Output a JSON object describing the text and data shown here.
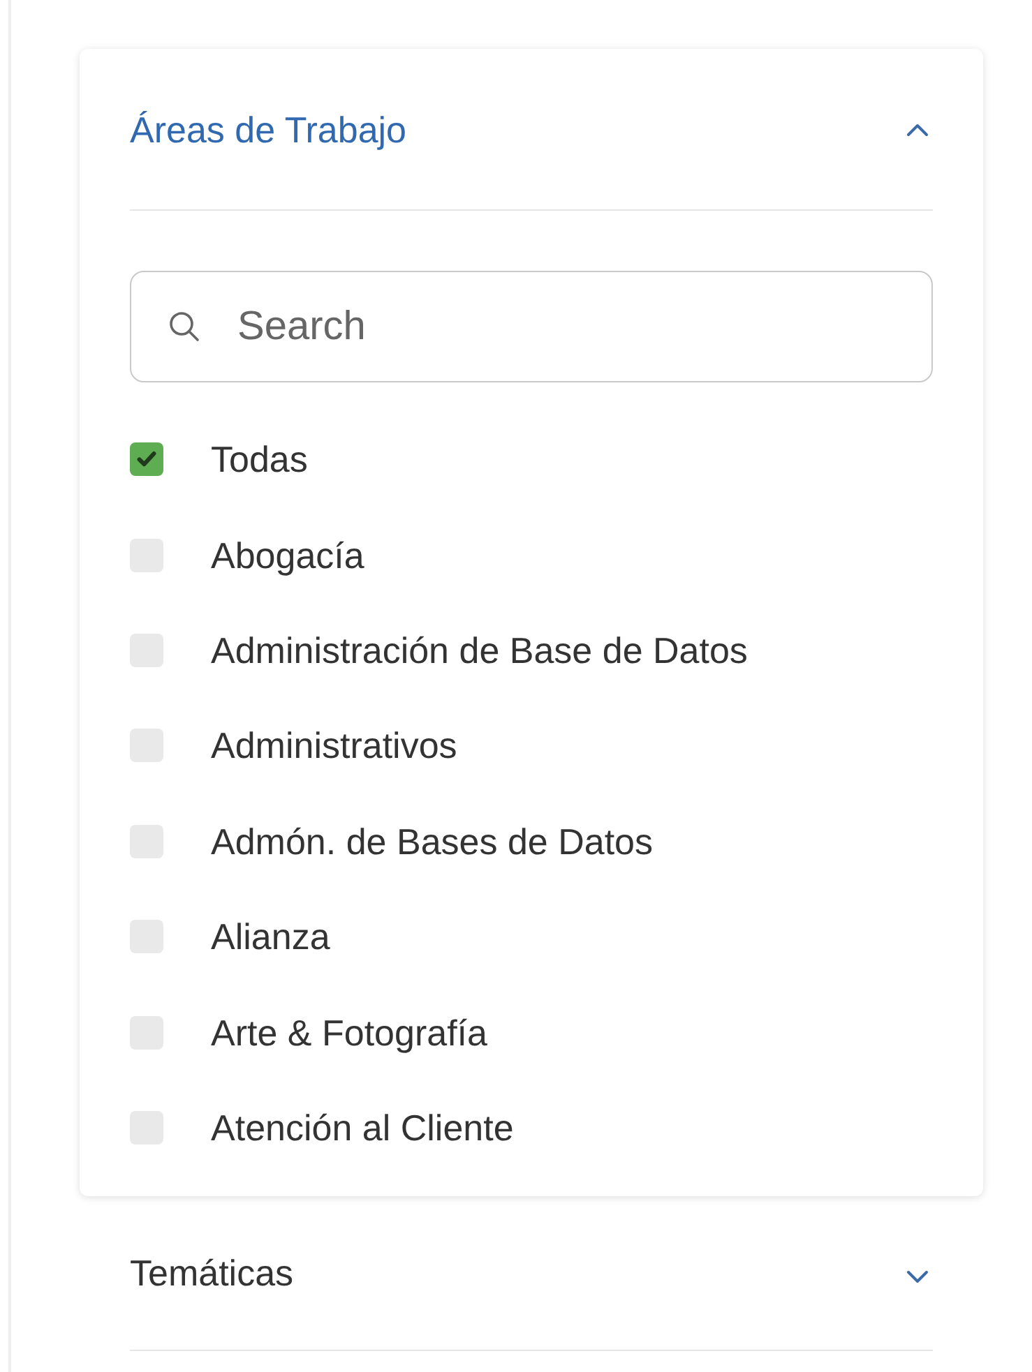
{
  "sections": [
    {
      "title": "Áreas de Trabajo",
      "expanded": true,
      "search": {
        "placeholder": "Search"
      },
      "options": [
        {
          "label": "Todas",
          "checked": true
        },
        {
          "label": "Abogacía",
          "checked": false
        },
        {
          "label": "Administración de Base de Datos",
          "checked": false
        },
        {
          "label": "Administrativos",
          "checked": false
        },
        {
          "label": "Admón. de Bases de Datos",
          "checked": false
        },
        {
          "label": "Alianza",
          "checked": false
        },
        {
          "label": "Arte & Fotografía",
          "checked": false
        },
        {
          "label": "Atención al Cliente",
          "checked": false
        }
      ]
    },
    {
      "title": "Temáticas",
      "expanded": false
    }
  ]
}
